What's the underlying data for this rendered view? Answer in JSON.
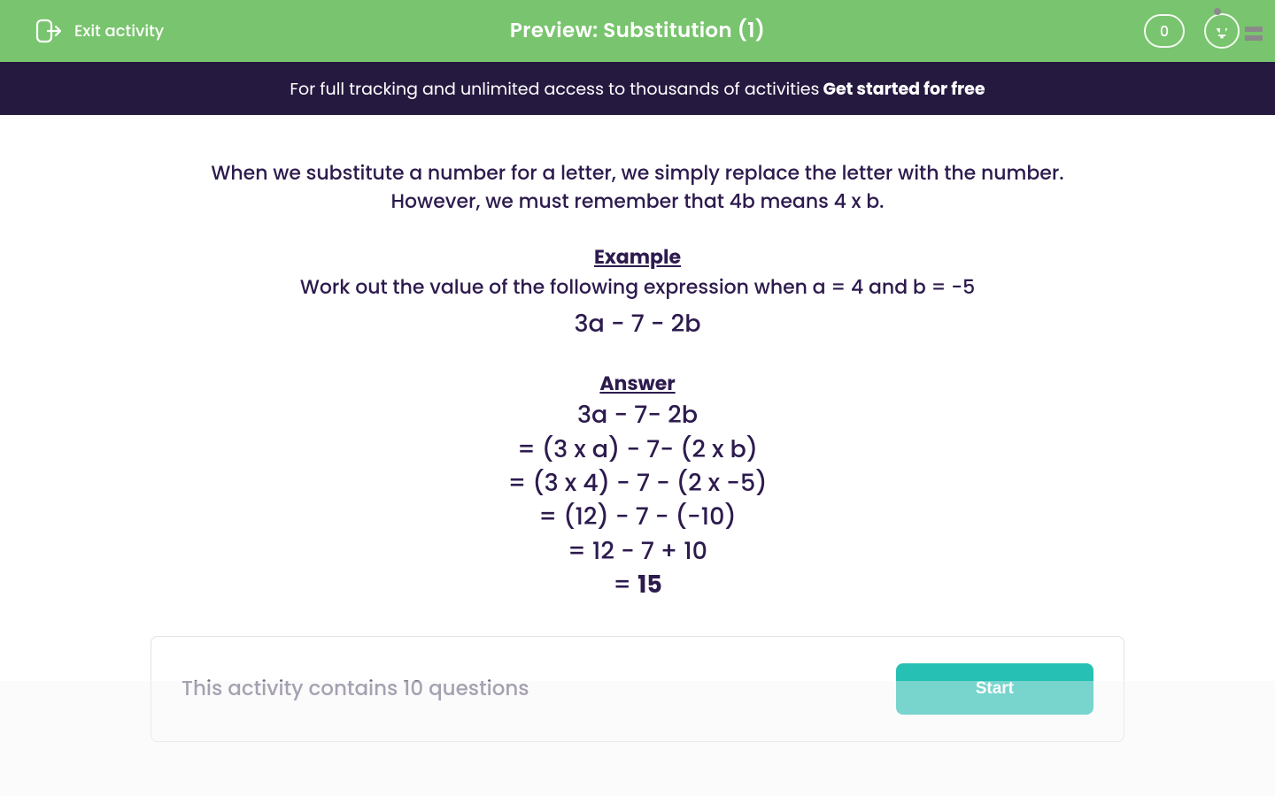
{
  "header": {
    "exit_label": "Exit activity",
    "title": "Preview: Substitution (1)",
    "points": "0"
  },
  "banner": {
    "text": "For full tracking and unlimited access to thousands of activities",
    "cta": "Get started for free"
  },
  "intro": {
    "line1": "When we substitute a number for a letter, we simply replace the letter with the number.",
    "line2": "However, we must remember that 4b means 4 x b."
  },
  "example": {
    "heading": "Example",
    "prompt": "Work out the value of the following expression when a = 4 and b = -5",
    "expression": "3a - 7 - 2b"
  },
  "answer": {
    "heading": "Answer",
    "lines": [
      "3a - 7- 2b",
      "= (3 x a) - 7- (2 x b)",
      "= (3 x 4) - 7 - (2 x -5)",
      "= (12) - 7 - (-10)",
      "= 12 - 7 + 10"
    ],
    "final_prefix": "= ",
    "final_value": "15"
  },
  "activity": {
    "text": "This activity contains 10 questions",
    "start_label": "Start"
  },
  "icons": {
    "exit": "exit-icon",
    "trophy": "trophy-icon",
    "corner": "math-symbols"
  },
  "colors": {
    "header_bg": "#79c46e",
    "banner_bg": "#261940",
    "start_btn": "#26c0b4",
    "text": "#2d1b4e"
  }
}
